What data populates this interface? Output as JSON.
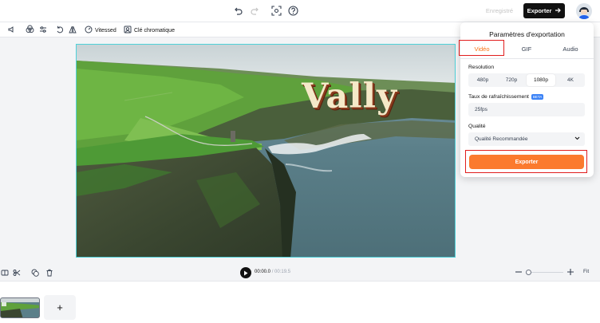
{
  "header": {
    "register_label": "Enregistré",
    "export_label": "Exporter"
  },
  "toolbar": {
    "speed_label": "Vitessed",
    "chroma_label": "Clé chromatique"
  },
  "canvas": {
    "overlay_text": "Vally"
  },
  "export_panel": {
    "title": "Paramètres d'exportation",
    "tabs": [
      {
        "label": "Vidéo",
        "active": true
      },
      {
        "label": "GIF",
        "active": false
      },
      {
        "label": "Audio",
        "active": false
      }
    ],
    "resolution_label": "Resolution",
    "resolutions": [
      "480p",
      "720p",
      "1080p",
      "4K"
    ],
    "selected_resolution": "1080p",
    "framerate_label": "Taux de rafraîchissement",
    "beta_badge": "BETA",
    "framerate_value": "25fps",
    "quality_label": "Qualité",
    "quality_value": "Qualité Recommandée",
    "export_button": "Exporter"
  },
  "playback": {
    "current_time": "00:00.0",
    "duration": "/ 00:19.5",
    "fit_label": "Fit"
  },
  "timeline": {
    "add_label": "+"
  },
  "colors": {
    "accent": "#fb7a2e",
    "highlight": "#e11d1d",
    "selection": "#4fd1d9"
  }
}
